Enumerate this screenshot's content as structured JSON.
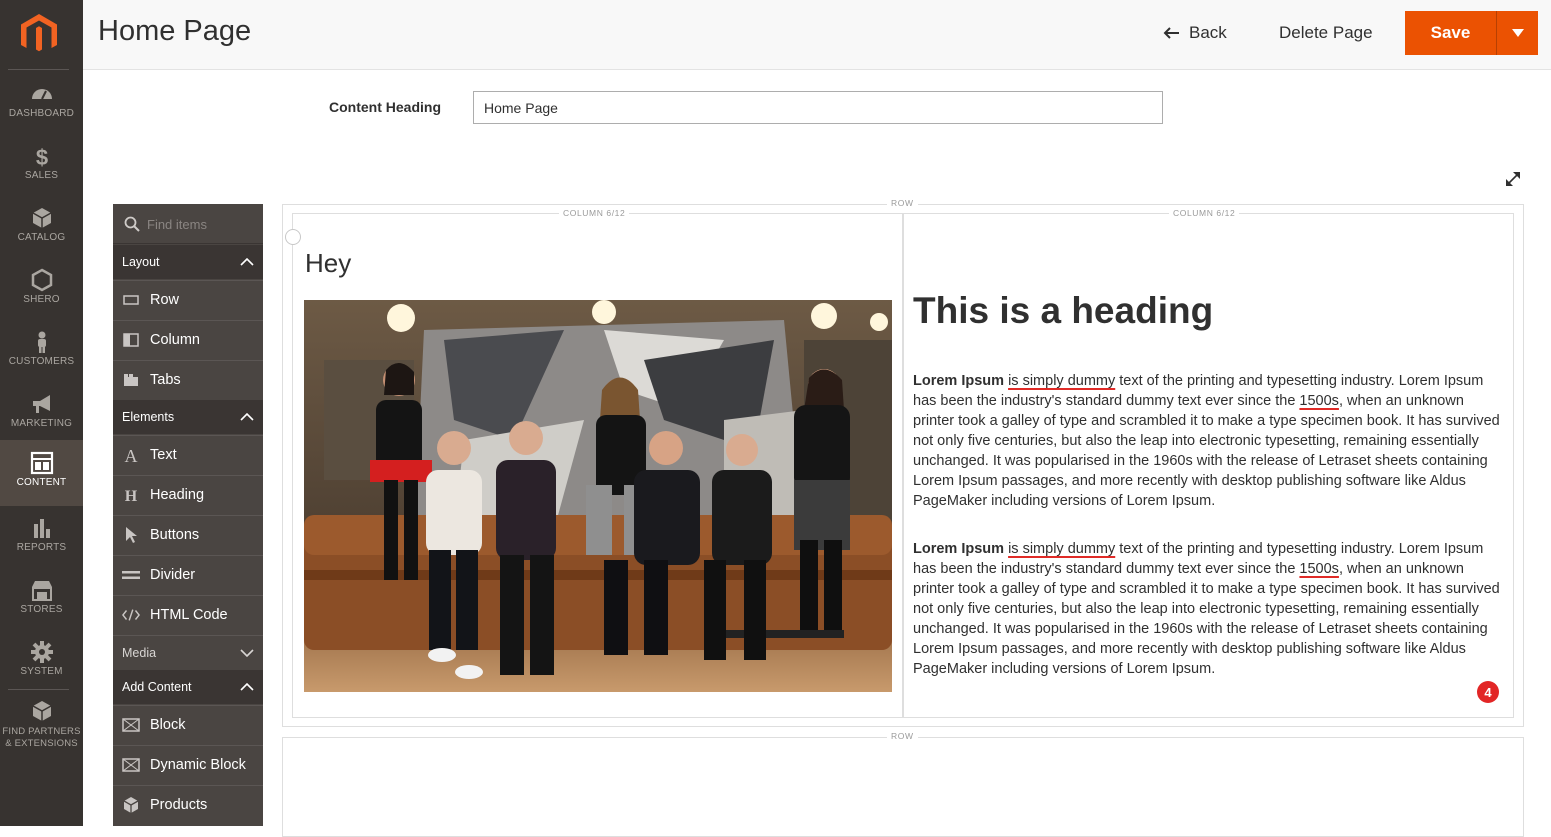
{
  "nav": {
    "items": [
      {
        "label": "DASHBOARD",
        "icon": "dashboard-icon"
      },
      {
        "label": "SALES",
        "icon": "dollar-icon"
      },
      {
        "label": "CATALOG",
        "icon": "box-icon"
      },
      {
        "label": "SHERO",
        "icon": "hexagon-icon"
      },
      {
        "label": "CUSTOMERS",
        "icon": "person-icon"
      },
      {
        "label": "MARKETING",
        "icon": "megaphone-icon"
      },
      {
        "label": "CONTENT",
        "icon": "layout-icon",
        "active": true
      },
      {
        "label": "REPORTS",
        "icon": "bar-chart-icon"
      },
      {
        "label": "STORES",
        "icon": "store-icon"
      },
      {
        "label": "SYSTEM",
        "icon": "gear-icon"
      },
      {
        "label": "FIND PARTNERS & EXTENSIONS",
        "icon": "cubes-icon"
      }
    ]
  },
  "header": {
    "title": "Home Page",
    "back_label": "Back",
    "delete_label": "Delete Page",
    "save_label": "Save"
  },
  "form": {
    "content_heading_label": "Content Heading",
    "content_heading_value": "Home Page"
  },
  "panel": {
    "search_placeholder": "Find items",
    "groups": {
      "layout": "Layout",
      "elements": "Elements",
      "media": "Media",
      "add_content": "Add Content"
    },
    "layout_items": [
      "Row",
      "Column",
      "Tabs"
    ],
    "element_items": [
      "Text",
      "Heading",
      "Buttons",
      "Divider",
      "HTML Code"
    ],
    "add_content_items": [
      "Block",
      "Dynamic Block",
      "Products"
    ]
  },
  "stage": {
    "row_label": "ROW",
    "column_label": "COLUMN 6/12",
    "left_heading": "Hey",
    "right_heading": "This is a heading",
    "para_bold": "Lorem Ipsum",
    "para_underlined_1": "is simply dummy",
    "para_mid": "text of the printing and typesetting industry. Lorem Ipsum has been the industry's standard dummy text ever since the",
    "para_underlined_2": "1500s",
    "para_end": ", when an unknown printer took a galley of type and scrambled it to make a type specimen book. It has survived not only five centuries, but also the leap into electronic typesetting, remaining essentially unchanged. It was popularised in the 1960s with the release of Letraset sheets containing Lorem Ipsum passages, and more recently with desktop publishing software like Aldus PageMaker including versions of Lorem Ipsum.",
    "badge_count": "4"
  },
  "colors": {
    "nav_bg": "#373330",
    "nav_active": "#514943",
    "accent": "#eb5202",
    "panel_bg": "#4a4542",
    "panel_group_bg": "#3a3533"
  }
}
